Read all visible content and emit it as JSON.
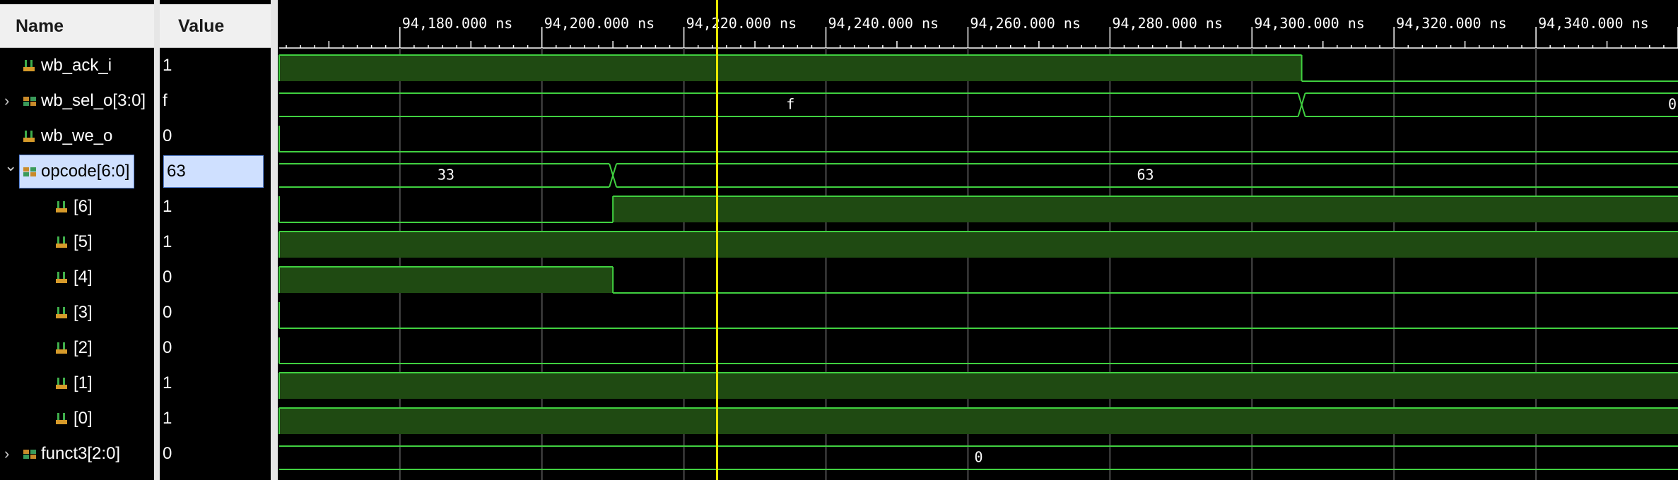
{
  "headers": {
    "name": "Name",
    "value": "Value"
  },
  "time_labels": [
    "94,180.000 ns",
    "94,200.000 ns",
    "94,220.000 ns",
    "94,240.000 ns",
    "94,260.000 ns",
    "94,280.000 ns",
    "94,300.000 ns",
    "94,320.000 ns",
    "94,340.000 ns"
  ],
  "signals": [
    {
      "name": "wb_ack_i",
      "value": "1",
      "expandable": false,
      "bus": false,
      "indent": 0
    },
    {
      "name": "wb_sel_o[3:0]",
      "value": "f",
      "expandable": true,
      "expanded": false,
      "bus": true,
      "indent": 0
    },
    {
      "name": "wb_we_o",
      "value": "0",
      "expandable": false,
      "bus": false,
      "indent": 0
    },
    {
      "name": "opcode[6:0]",
      "value": "63",
      "expandable": true,
      "expanded": true,
      "bus": true,
      "indent": 0,
      "selected": true
    },
    {
      "name": "[6]",
      "value": "1",
      "expandable": false,
      "bus": false,
      "indent": 1
    },
    {
      "name": "[5]",
      "value": "1",
      "expandable": false,
      "bus": false,
      "indent": 1
    },
    {
      "name": "[4]",
      "value": "0",
      "expandable": false,
      "bus": false,
      "indent": 1
    },
    {
      "name": "[3]",
      "value": "0",
      "expandable": false,
      "bus": false,
      "indent": 1
    },
    {
      "name": "[2]",
      "value": "0",
      "expandable": false,
      "bus": false,
      "indent": 1
    },
    {
      "name": "[1]",
      "value": "1",
      "expandable": false,
      "bus": false,
      "indent": 1
    },
    {
      "name": "[0]",
      "value": "1",
      "expandable": false,
      "bus": false,
      "indent": 1
    },
    {
      "name": "funct3[2:0]",
      "value": "0",
      "expandable": true,
      "expanded": false,
      "bus": true,
      "indent": 0
    }
  ],
  "waveforms": [
    {
      "kind": "bit",
      "segments": [
        [
          94163,
          94307,
          1
        ],
        [
          94307,
          94360,
          0
        ]
      ]
    },
    {
      "kind": "bus",
      "segments": [
        [
          94163,
          94307,
          "f"
        ],
        [
          94307,
          94360,
          "0"
        ]
      ]
    },
    {
      "kind": "bit",
      "segments": [
        [
          94163,
          94360,
          0
        ]
      ]
    },
    {
      "kind": "bus",
      "segments": [
        [
          94163,
          94210,
          "33"
        ],
        [
          94210,
          94360,
          "63"
        ]
      ]
    },
    {
      "kind": "bit",
      "segments": [
        [
          94163,
          94210,
          0
        ],
        [
          94210,
          94360,
          1
        ]
      ]
    },
    {
      "kind": "bit",
      "segments": [
        [
          94163,
          94360,
          1
        ]
      ]
    },
    {
      "kind": "bit",
      "segments": [
        [
          94163,
          94210,
          1
        ],
        [
          94210,
          94360,
          0
        ]
      ]
    },
    {
      "kind": "bit",
      "segments": [
        [
          94163,
          94360,
          0
        ]
      ]
    },
    {
      "kind": "bit",
      "segments": [
        [
          94163,
          94360,
          0
        ]
      ]
    },
    {
      "kind": "bit",
      "segments": [
        [
          94163,
          94360,
          1
        ]
      ]
    },
    {
      "kind": "bit",
      "segments": [
        [
          94163,
          94360,
          1
        ]
      ]
    },
    {
      "kind": "bus",
      "segments": [
        [
          94163,
          94360,
          "0"
        ]
      ]
    }
  ],
  "time_range_ns": [
    94163,
    94360
  ],
  "cursor_time_ns": 94224.6,
  "colors": {
    "wave_line": "#40d040",
    "wave_fill": "#1f4a12",
    "grid": "#4a4a4a",
    "cursor": "#e8e800"
  }
}
